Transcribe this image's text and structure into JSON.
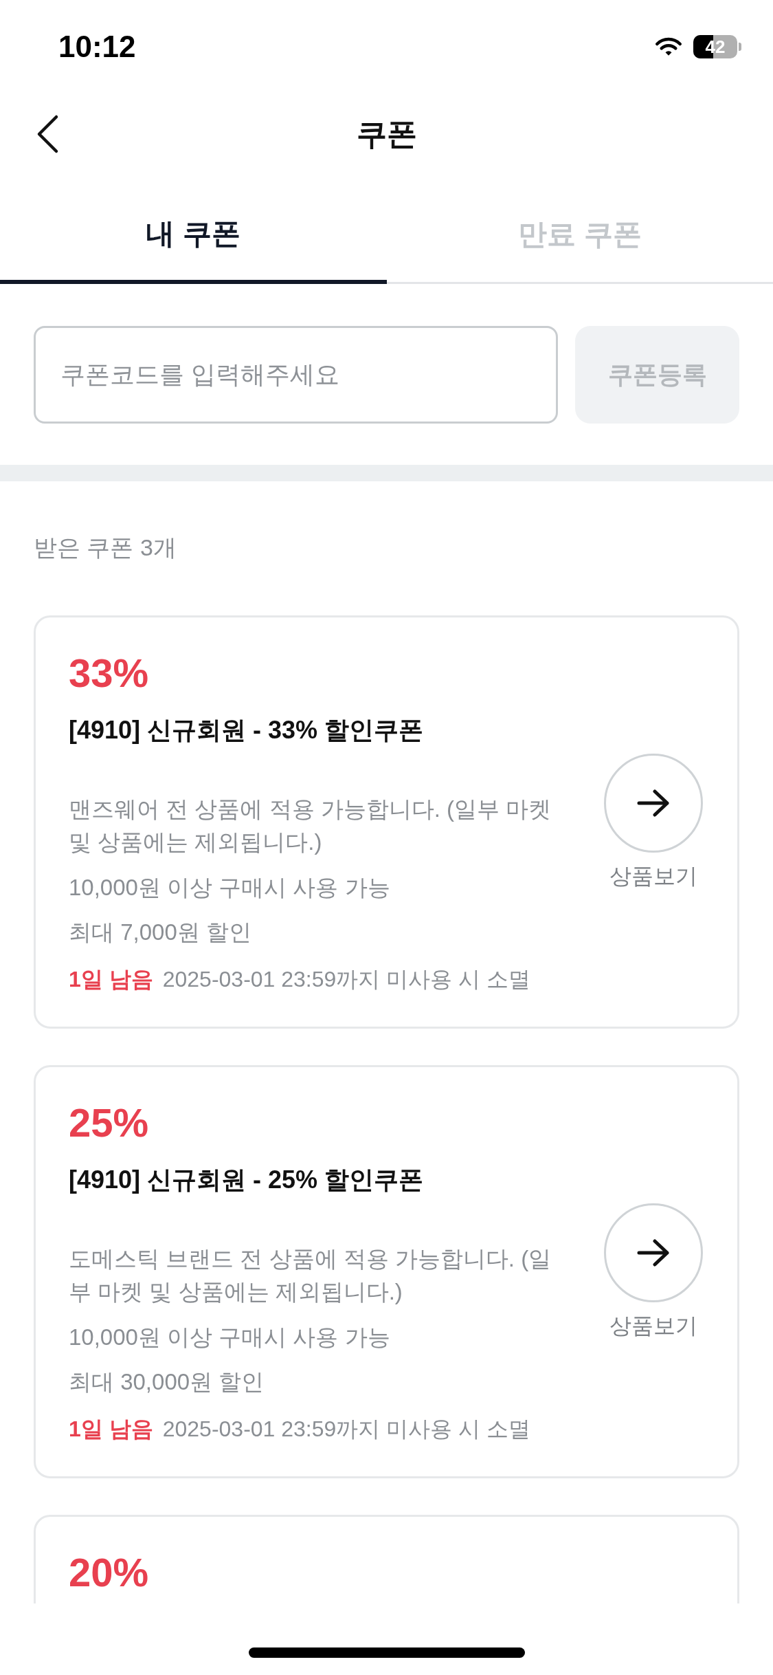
{
  "status_bar": {
    "time": "10:12",
    "battery": "42"
  },
  "header": {
    "title": "쿠폰"
  },
  "tabs": [
    {
      "label": "내 쿠폰",
      "selected": true
    },
    {
      "label": "만료 쿠폰",
      "selected": false
    }
  ],
  "coupon_form": {
    "placeholder": "쿠폰코드를 입력해주세요",
    "button": {
      "label": "쿠폰등록",
      "disabled": true
    }
  },
  "received_count": "받은 쿠폰 3개",
  "coupons": [
    {
      "discount": "33%",
      "title": "[4910] 신규회원 - 33% 할인쿠폰",
      "description": "맨즈웨어 전 상품에 적용 가능합니다. (일부 마켓 및 상품에는 제외됩니다.)",
      "min_purchase": "10,000원 이상 구매시 사용 가능",
      "max_discount": "최대 7,000원 할인",
      "remaining": "1일 남음",
      "expiry": "2025-03-01 23:59까지 미사용 시 소멸",
      "action": "상품보기"
    },
    {
      "discount": "25%",
      "title": "[4910] 신규회원 - 25% 할인쿠폰",
      "description": "도메스틱 브랜드 전 상품에 적용 가능합니다. (일부 마켓 및 상품에는 제외됩니다.)",
      "min_purchase": "10,000원 이상 구매시 사용 가능",
      "max_discount": "최대 30,000원 할인",
      "remaining": "1일 남음",
      "expiry": "2025-03-01 23:59까지 미사용 시 소멸",
      "action": "상품보기"
    },
    {
      "discount": "20%"
    }
  ]
}
